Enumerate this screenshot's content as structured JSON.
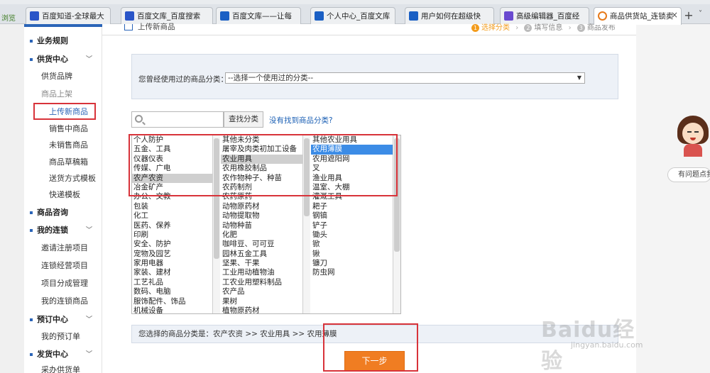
{
  "browser": {
    "left_label": "浏览",
    "tabs": [
      {
        "label": "百度知道-全球最大",
        "icon": "paw-icon"
      },
      {
        "label": "百度文库_百度搜索",
        "icon": "paw-icon"
      },
      {
        "label": "百度文库——让每",
        "icon": "doc-icon"
      },
      {
        "label": "个人中心_百度文库",
        "icon": "doc-icon"
      },
      {
        "label": "用户如何在超级快",
        "icon": "doc-icon"
      },
      {
        "label": "高级编辑器_百度经",
        "icon": "grid-icon"
      },
      {
        "label": "商品供货站_连锁卖",
        "icon": "store-icon",
        "active": true
      }
    ],
    "new_tab_label": "+",
    "more_label": "˅"
  },
  "sidebar": {
    "sections": [
      {
        "label": "业务规则"
      },
      {
        "label": "供货中心"
      },
      {
        "label": "商品咨询"
      },
      {
        "label": "我的连锁"
      },
      {
        "label": "预订中心"
      },
      {
        "label": "发货中心"
      }
    ],
    "supply_items": [
      "供货品牌",
      "商品上架",
      "上传新商品",
      "销售中商品",
      "未销售商品",
      "商品草稿箱",
      "送货方式模板",
      "快递模板"
    ],
    "chain_items": [
      "邀请注册项目",
      "连锁经营项目",
      "项目分成管理",
      "我的连锁商品"
    ],
    "booking_items": [
      "我的预订单"
    ],
    "shipping_items": [
      "采办供货单"
    ]
  },
  "main": {
    "title": "上传新商品",
    "steps": [
      "选择分类",
      "填写信息",
      "商品发布"
    ],
    "used_label": "您曾经使用过的商品分类：",
    "used_select_value": "--选择一个使用过的分类--",
    "search_placeholder": "",
    "search_button": "查找分类",
    "not_found_link": "没有找到商品分类?",
    "col1": [
      "个人防护",
      "五金、工具",
      "仪器仪表",
      "传媒、广电",
      "农产农资",
      "冶金矿产",
      "办公、文教",
      "包装",
      "化工",
      "医药、保养",
      "印刷",
      "安全、防护",
      "宠物及园艺",
      "家用电器",
      "家装、建材",
      "工艺礼品",
      "数码、电脑",
      "服饰配件、饰品",
      "机械设备"
    ],
    "col2": [
      "其他未分类",
      "屠宰及肉类初加工设备",
      "农业用具",
      "农用橡胶制品",
      "农作物种子、种苗",
      "农药制剂",
      "农药原药",
      "动物原药材",
      "动物提取物",
      "动物种苗",
      "化肥",
      "咖啡豆、可可豆",
      "园林五金工具",
      "坚果、干果",
      "工业用动植物油",
      "工农业用塑料制品",
      "农产品",
      "果树",
      "植物原药材"
    ],
    "col3": [
      "其他农业用具",
      "农用薄膜",
      "农用遮阳网",
      "叉",
      "渔业用具",
      "温室、大棚",
      "灌溉工具",
      "耙子",
      "钢镐",
      "铲子",
      "锄头",
      "锨",
      "锹",
      "镰刀",
      "防虫网"
    ],
    "selected_text": "您选择的商品分类是：农产农资 >> 农业用具 >> 农用薄膜",
    "next_button": "下一步"
  },
  "helper": {
    "ask_label": "有问题点我"
  },
  "watermark": {
    "logo": "Baidu经验",
    "url": "jingyan.baidu.com"
  },
  "colors": {
    "accent": "#2b65b8",
    "next_button": "#f07d22",
    "highlight": "#d8333a",
    "selected_blue": "#3c8ce6"
  }
}
